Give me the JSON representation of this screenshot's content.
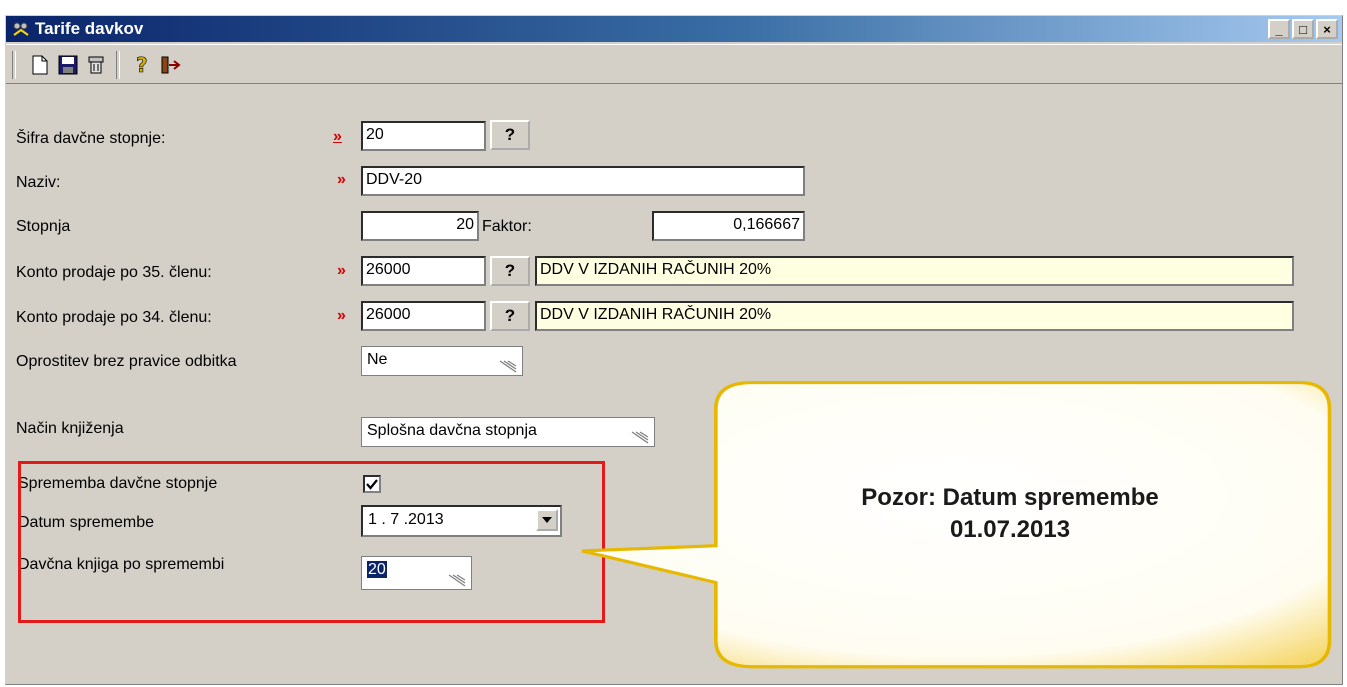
{
  "window": {
    "title": "Tarife davkov",
    "controls": [
      "_",
      "□",
      "×"
    ]
  },
  "toolbar": {
    "icons": [
      "new-document-icon",
      "save-icon",
      "delete-icon",
      "help-icon",
      "exit-icon"
    ]
  },
  "form": {
    "sifra": {
      "label": "Šifra davčne stopnje:",
      "marker": "»",
      "value": "20",
      "lookup": "?"
    },
    "naziv": {
      "label": "Naziv:",
      "marker": "»",
      "value": "DDV-20"
    },
    "stopnja": {
      "label": "Stopnja",
      "value": "20",
      "faktor_label": "Faktor:",
      "faktor_value": "0,166667"
    },
    "konto35": {
      "label": "Konto prodaje po 35. členu:",
      "marker": "»",
      "value": "26000",
      "lookup": "?",
      "description": "DDV V IZDANIH RAČUNIH 20%"
    },
    "konto34": {
      "label": "Konto prodaje po 34. členu:",
      "marker": "»",
      "value": "26000",
      "lookup": "?",
      "description": "DDV V IZDANIH RAČUNIH 20%"
    },
    "oprostitev": {
      "label": "Oprostitev brez pravice odbitka",
      "value": "Ne"
    },
    "nacin": {
      "label": "Način knjiženja",
      "value": "Splošna davčna stopnja"
    },
    "sprememba": {
      "label": "Sprememba davčne stopnje",
      "checked": true
    },
    "datum": {
      "label": "Datum spremembe",
      "value": "1 . 7 .2013"
    },
    "knjiga": {
      "label": "Davčna knjiga po spremembi",
      "value": "20"
    }
  },
  "callout": {
    "line1": "Pozor: Datum spremembe",
    "line2": "01.07.2013"
  },
  "colors": {
    "highlight_box": "#e21a1a",
    "callout_fill": "#ffffff",
    "callout_border": "#f2c400",
    "required_marker": "#d40000"
  }
}
